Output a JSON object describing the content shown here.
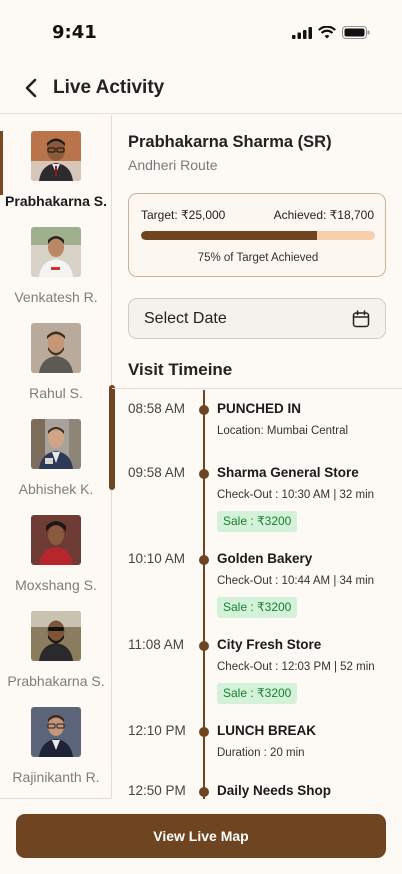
{
  "status_bar": {
    "time": "9:41"
  },
  "header": {
    "title": "Live Activity"
  },
  "sidebar": {
    "items": [
      {
        "label": "Prabhakarna S.",
        "active": true,
        "avatar_bg": "#b9744b"
      },
      {
        "label": "Venkatesh R.",
        "active": false,
        "avatar_bg": "#d8d2c8"
      },
      {
        "label": "Rahul S.",
        "active": false,
        "avatar_bg": "#b8ab9c"
      },
      {
        "label": "Abhishek K.",
        "active": false,
        "avatar_bg": "#a7a39b"
      },
      {
        "label": "Moxshang S.",
        "active": false,
        "avatar_bg": "#6e3b35"
      },
      {
        "label": "Prabhakarna S.",
        "active": false,
        "avatar_bg": "#8a7c5e"
      },
      {
        "label": "Rajinikanth R.",
        "active": false,
        "avatar_bg": "#5b6478"
      }
    ]
  },
  "profile": {
    "name": "Prabhakarna Sharma (SR)",
    "route": "Andheri Route"
  },
  "target": {
    "target_label": "Target: ₹25,000",
    "achieved_label": "Achieved: ₹18,700",
    "progress_percent": 75,
    "caption": "75% of Target Achieved"
  },
  "date_field": {
    "label": "Select Date"
  },
  "timeline": {
    "title": "Visit Timeine",
    "entries": [
      {
        "time": "08:58 AM",
        "title": "PUNCHED IN",
        "sub": "Location: Mumbai Central",
        "sale": ""
      },
      {
        "time": "09:58 AM",
        "title": "Sharma General Store",
        "sub": "Check-Out : 10:30 AM | 32 min",
        "sale": "Sale : ₹3200"
      },
      {
        "time": "10:10 AM",
        "title": "Golden Bakery",
        "sub": "Check-Out : 10:44 AM | 34 min",
        "sale": "Sale : ₹3200"
      },
      {
        "time": "11:08 AM",
        "title": "City Fresh Store",
        "sub": "Check-Out : 12:03 PM  | 52 min",
        "sale": "Sale : ₹3200"
      },
      {
        "time": "12:10 PM",
        "title": "LUNCH BREAK",
        "sub": "Duration : 20 min",
        "sale": ""
      },
      {
        "time": "12:50 PM",
        "title": "Daily Needs Shop",
        "sub": "",
        "sale": ""
      }
    ]
  },
  "footer": {
    "button_label": "View Live Map"
  },
  "colors": {
    "accent": "#6f4420",
    "progress_track": "#f6cfae",
    "sale_bg": "#d4f2d9",
    "sale_text": "#16812f"
  }
}
